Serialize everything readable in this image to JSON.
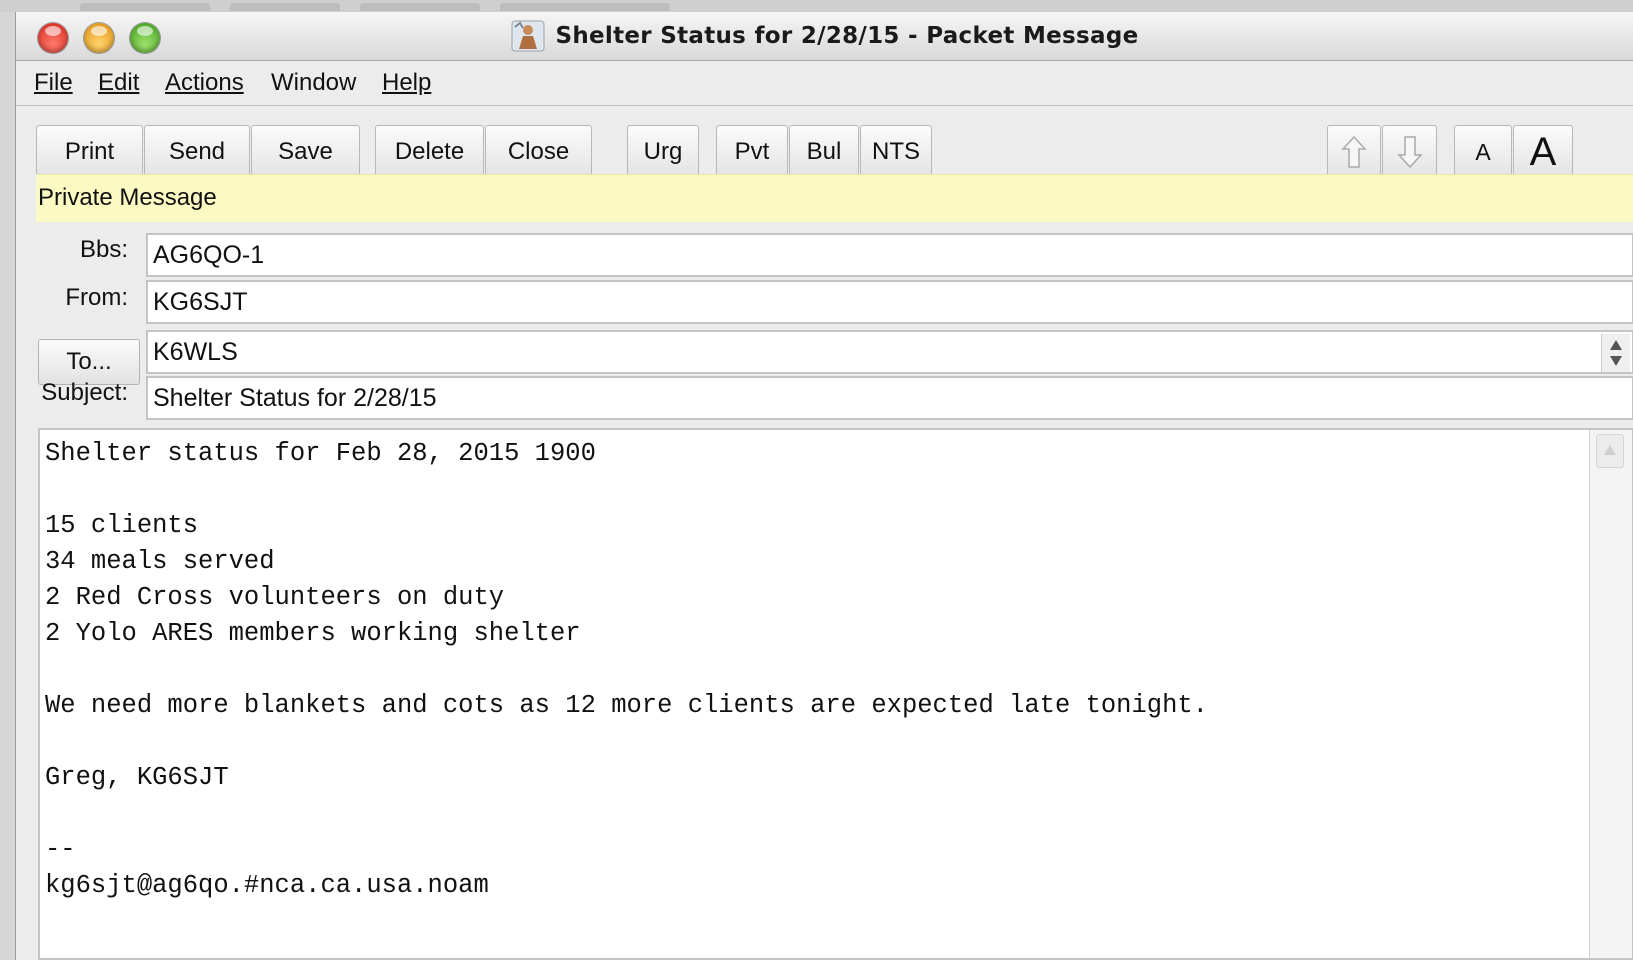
{
  "window": {
    "title": "Shelter Status for 2/28/15 - Packet Message",
    "app_icon": "outpost-app-icon"
  },
  "menu": [
    {
      "label": "File"
    },
    {
      "label": "Edit"
    },
    {
      "label": "Actions"
    },
    {
      "label": "Window"
    },
    {
      "label": "Help"
    }
  ],
  "toolbar": {
    "print": "Print",
    "send": "Send",
    "save": "Save",
    "delete": "Delete",
    "close": "Close",
    "urg": "Urg",
    "pvt": "Pvt",
    "bul": "Bul",
    "nts": "NTS",
    "prev_icon": "arrow-up-icon",
    "next_icon": "arrow-down-icon",
    "font_small": "A",
    "font_large": "A"
  },
  "banner": {
    "text": "Private Message",
    "color": "#fafac2"
  },
  "header": {
    "bbs_label": "Bbs:",
    "bbs_value": "AG6QO-1",
    "from_label": "From:",
    "from_value": "KG6SJT",
    "to_button": "To...",
    "to_value": "K6WLS",
    "subject_label": "Subject:",
    "subject_value": "Shelter Status for 2/28/15"
  },
  "message": {
    "body": "Shelter status for Feb 28, 2015 1900\n\n15 clients\n34 meals served\n2 Red Cross volunteers on duty\n2 Yolo ARES members working shelter\n\nWe need more blankets and cots as 12 more clients are expected late tonight.\n\nGreg, KG6SJT\n\n--\nkg6sjt@ag6qo.#nca.ca.usa.noam"
  }
}
